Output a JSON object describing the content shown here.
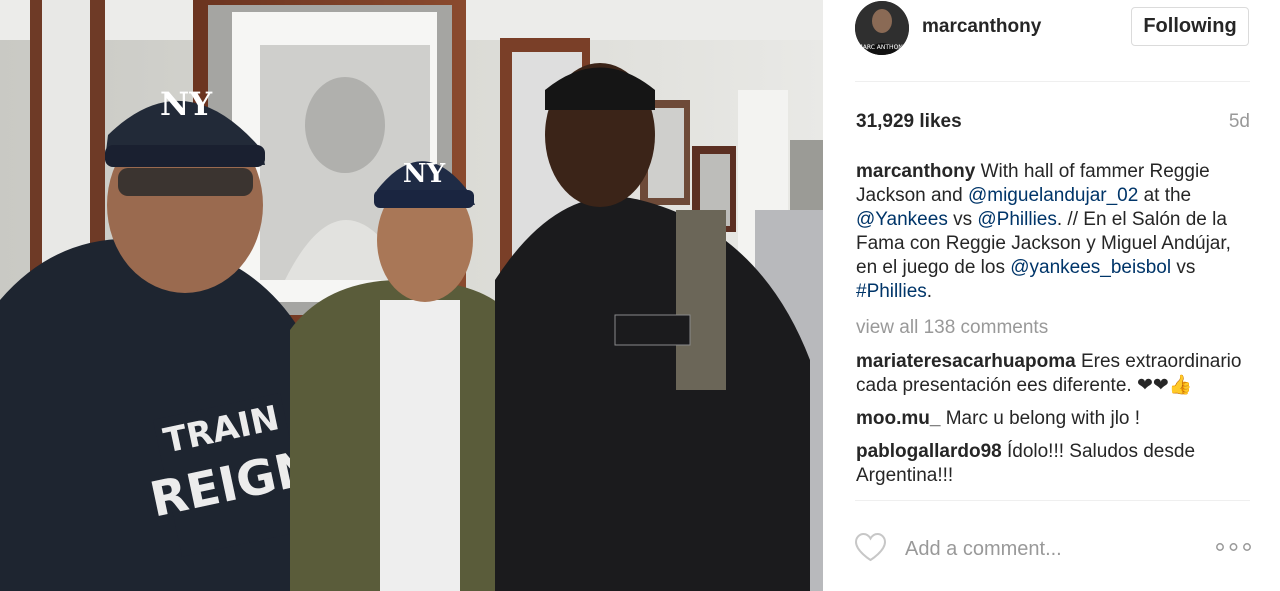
{
  "post": {
    "photo_icon": "photo",
    "username": "marcanthony",
    "follow_label": "Following",
    "likes": "31,929 likes",
    "age": "5d",
    "caption": {
      "username": "marcanthony",
      "parts": [
        " With hall of fammer Reggie Jackson and ",
        "@miguelandujar_02",
        " at the ",
        "@Yankees",
        " vs ",
        "@Phillies",
        ". // En el Salón de la Fama con Reggie Jackson y Miguel Andújar, en el juego de los ",
        "@yankees_beisbol",
        " vs ",
        "#Phillies",
        "."
      ]
    },
    "view_all": "view all 138 comments",
    "comments": [
      {
        "user": "mariateresacarhuapoma",
        "text": " Eres extraordinario cada presentación ees diferente. ❤❤👍"
      },
      {
        "user": "moo.mu_",
        "text": " Marc u belong with jlo !"
      },
      {
        "user": "pablogallardo98",
        "text": " Ídolo!!! Saludos desde Argentina!!!"
      }
    ],
    "comment_placeholder": "Add a comment...",
    "icons": {
      "like": "heart-icon",
      "more": "more-options-icon",
      "avatar_text": "MARC ANTHONY"
    }
  }
}
